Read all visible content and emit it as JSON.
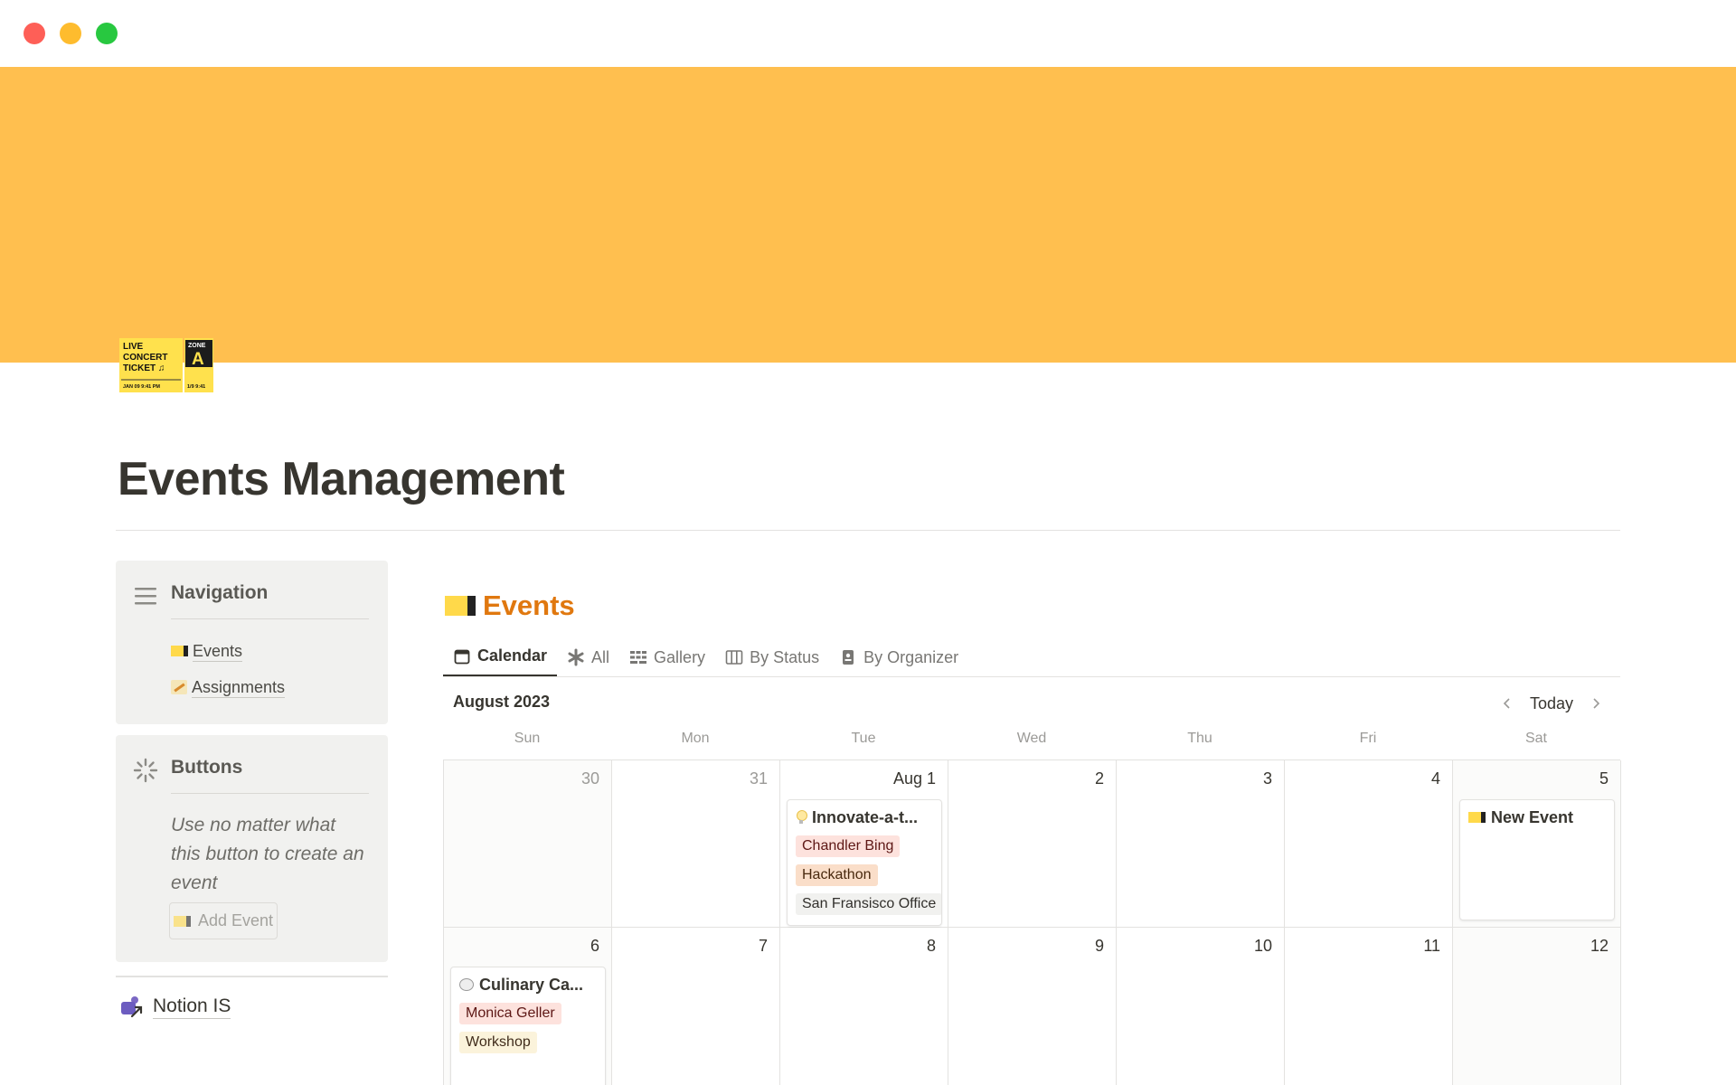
{
  "window": {
    "controls": [
      "close",
      "minimize",
      "zoom"
    ]
  },
  "cover": {
    "color": "#ffbf4f"
  },
  "page": {
    "title": "Events Management",
    "icon": "concert-ticket-icon"
  },
  "ticket_icon": {
    "line1": "LIVE",
    "line2": "CONCERT",
    "line3": "TICKET ♫",
    "stub_label": "ZONE",
    "stub_letter": "A",
    "date_left": "JAN 09   9:41 PM",
    "date_right": "1/9   9:41"
  },
  "navigation": {
    "heading": "Navigation",
    "icon": "hamburger-menu-icon",
    "links": [
      {
        "label": "Events",
        "icon": "ticket-icon"
      },
      {
        "label": "Assignments",
        "icon": "memo-icon"
      }
    ]
  },
  "buttons": {
    "heading": "Buttons",
    "icon": "sparkle-loader-icon",
    "description": "Use no matter what this button to create an event",
    "add_event_label": "Add Event"
  },
  "footer_link": {
    "label": "Notion IS",
    "icon": "teams-link-icon"
  },
  "database": {
    "title": "Events",
    "title_color": "#e0780f",
    "tabs": [
      {
        "label": "Calendar",
        "icon": "calendar-icon",
        "active": true
      },
      {
        "label": "All",
        "icon": "asterisk-icon",
        "active": false
      },
      {
        "label": "Gallery",
        "icon": "gallery-icon",
        "active": false
      },
      {
        "label": "By Status",
        "icon": "board-icon",
        "active": false
      },
      {
        "label": "By Organizer",
        "icon": "badge-icon",
        "active": false
      }
    ]
  },
  "calendar": {
    "month_label": "August 2023",
    "today_label": "Today",
    "weekdays": [
      "Sun",
      "Mon",
      "Tue",
      "Wed",
      "Thu",
      "Fri",
      "Sat"
    ],
    "week1": [
      "30",
      "31",
      "Aug 1",
      "2",
      "3",
      "4",
      "5"
    ],
    "week2": [
      "6",
      "7",
      "8",
      "9",
      "10",
      "11",
      "12"
    ],
    "events": [
      {
        "title": "Innovate-a-t...",
        "organizer": "Chandler Bing",
        "type": "Hackathon",
        "location": "San Fransisco Office"
      },
      {
        "title": "New Event"
      },
      {
        "title": "Culinary Ca...",
        "organizer": "Monica Geller",
        "type": "Workshop"
      }
    ]
  }
}
